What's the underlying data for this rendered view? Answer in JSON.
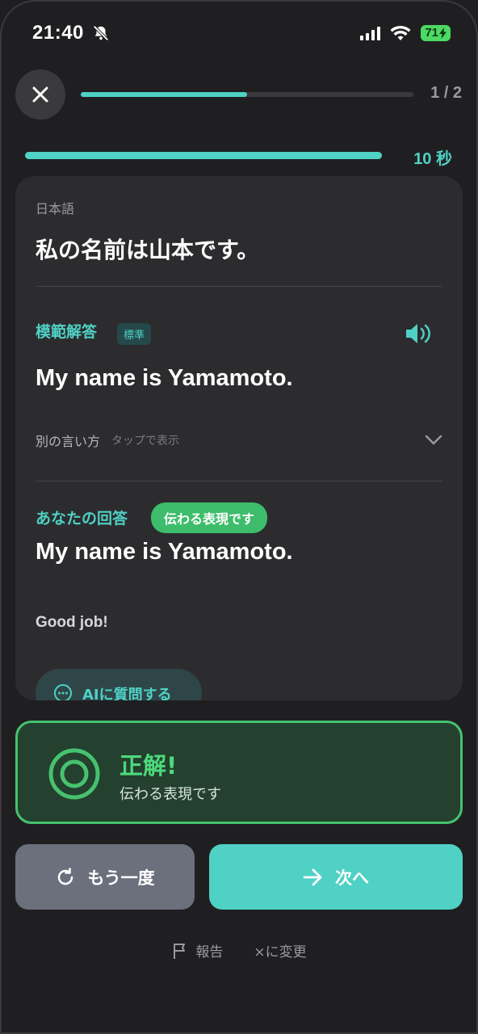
{
  "status": {
    "time": "21:40",
    "battery": "71"
  },
  "progress": {
    "count": "1 / 2",
    "question_fraction": 0.5,
    "timer_label": "10 秒",
    "timer_fraction": 1.0
  },
  "card": {
    "source_label": "日本語",
    "source_sentence": "私の名前は山本です。",
    "model_label": "模範解答",
    "model_badge": "標準",
    "model_answer": "My name is Yamamoto.",
    "alt_label": "別の言い方",
    "alt_hint": "タップで表示",
    "your_label": "あなたの回答",
    "your_badge": "伝わる表現です",
    "your_answer": "My name is Yamamoto.",
    "feedback": "Good job!",
    "ask_ai": "AIに質問する"
  },
  "result": {
    "title": "正解!",
    "subtitle": "伝わる表現です"
  },
  "buttons": {
    "retry": "もう一度",
    "next": "次へ"
  },
  "footer": {
    "report": "報告",
    "change": "×に変更"
  },
  "colors": {
    "accent": "#4fd1c5",
    "success": "#46c26f",
    "background": "#1f1f21",
    "card": "#2c2c2e"
  }
}
